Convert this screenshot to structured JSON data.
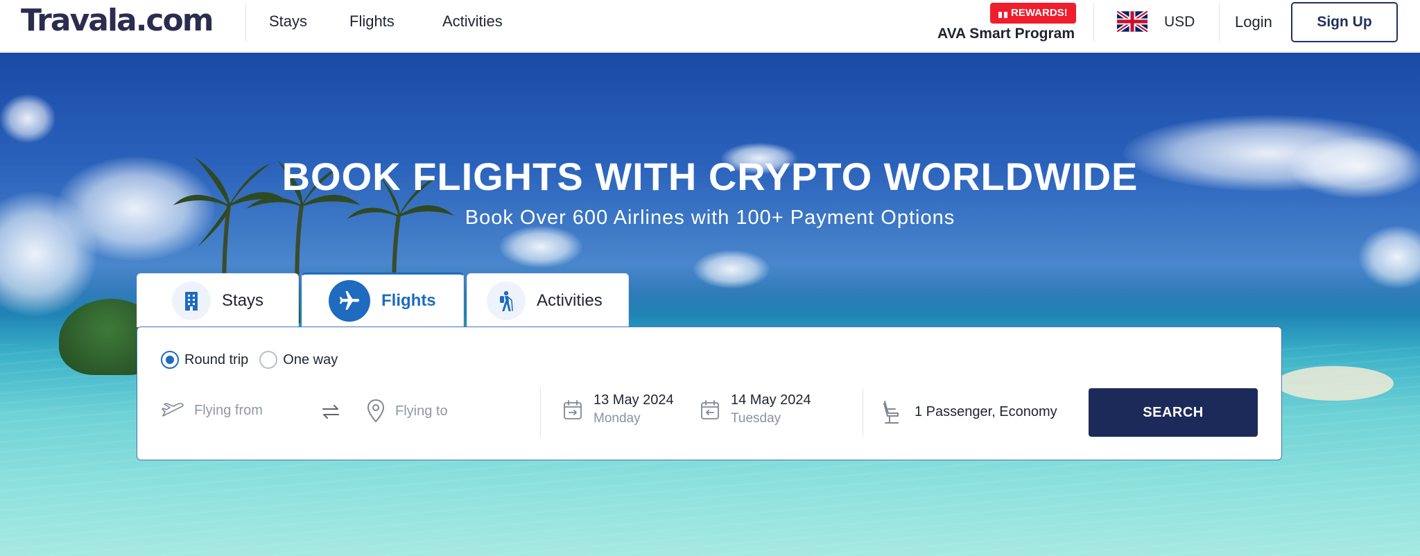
{
  "header": {
    "logo": "Travala.com",
    "nav": [
      "Stays",
      "Flights",
      "Activities"
    ],
    "rewards_badge": "REWARDS!",
    "ava_program": "AVA Smart Program",
    "flag_icon": "uk-flag-icon",
    "currency": "USD",
    "login": "Login",
    "signup": "Sign Up"
  },
  "hero": {
    "title": "BOOK FLIGHTS WITH CRYPTO WORLDWIDE",
    "subtitle": "Book Over 600 Airlines with 100+ Payment Options"
  },
  "tabs": [
    {
      "label": "Stays",
      "icon": "building-icon",
      "active": false
    },
    {
      "label": "Flights",
      "icon": "airplane-icon",
      "active": true
    },
    {
      "label": "Activities",
      "icon": "hiker-icon",
      "active": false
    }
  ],
  "search": {
    "trip_types": [
      {
        "label": "Round trip",
        "checked": true
      },
      {
        "label": "One way",
        "checked": false
      }
    ],
    "from_placeholder": "Flying from",
    "to_placeholder": "Flying to",
    "depart": {
      "date": "13 May 2024",
      "day": "Monday"
    },
    "return": {
      "date": "14 May 2024",
      "day": "Tuesday"
    },
    "passengers": "1 Passenger, Economy",
    "button": "SEARCH"
  },
  "colors": {
    "brand_navy": "#1c2a5a",
    "accent_blue": "#1e6bc0",
    "rewards_red": "#f01e2c"
  }
}
